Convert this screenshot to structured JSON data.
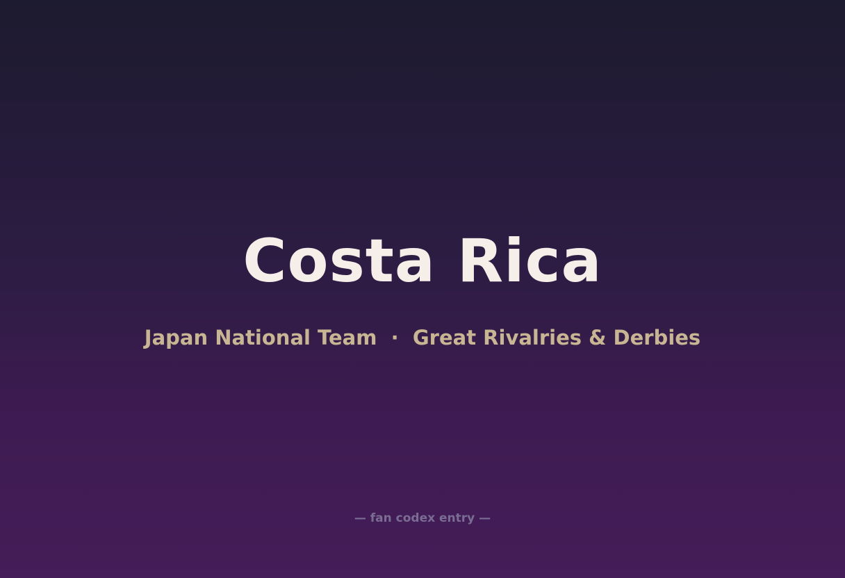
{
  "title": "Costa Rica",
  "subtitle": {
    "team": "Japan National Team",
    "separator": "·",
    "category": "Great Rivalries & Derbies"
  },
  "footer": "— fan codex entry —",
  "colors": {
    "background_top": "#1d1b2f",
    "background_bottom": "#451d58",
    "title": "#f6eee9",
    "subtitle": "#c8b592",
    "footer": "#7a6c92"
  }
}
